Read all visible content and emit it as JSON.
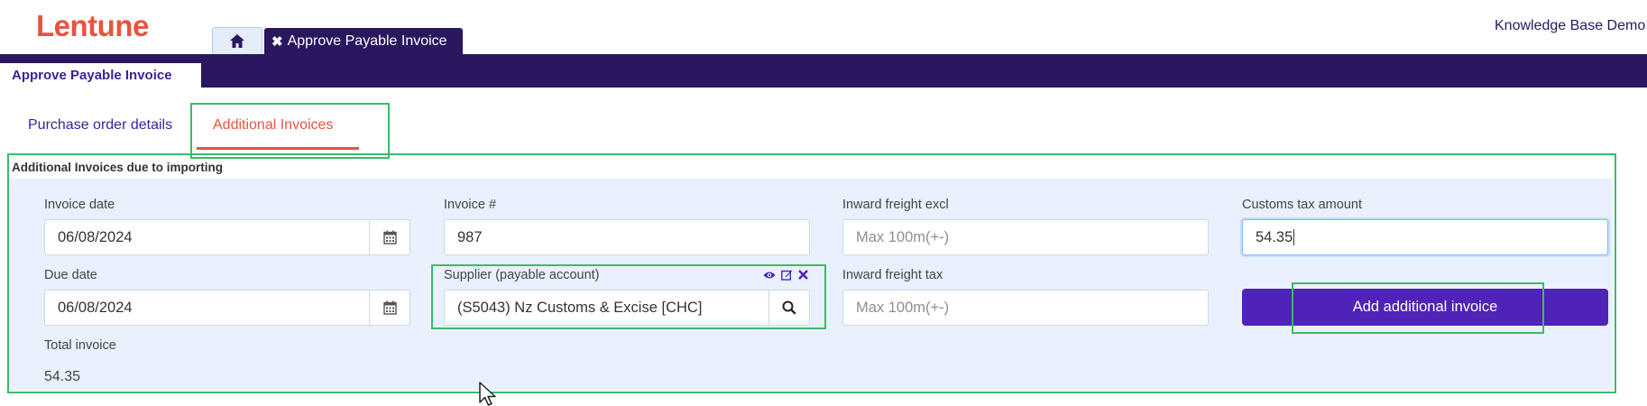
{
  "header": {
    "logo": "Lentune",
    "home_tab_icon": "home-icon",
    "active_tab_label": "Approve Payable Invoice",
    "active_tab_close_icon": "close-icon",
    "user_label": "Knowledge Base Demo"
  },
  "page_tab": {
    "label": "Approve Payable Invoice"
  },
  "subtabs": {
    "purchase_order": "Purchase order details",
    "additional_invoices": "Additional Invoices"
  },
  "section": {
    "title": "Additional Invoices due to importing"
  },
  "form": {
    "invoice_date": {
      "label": "Invoice date",
      "value": "06/08/2024",
      "icon": "calendar-icon"
    },
    "due_date": {
      "label": "Due date",
      "value": "06/08/2024",
      "icon": "calendar-icon"
    },
    "invoice_number": {
      "label": "Invoice #",
      "value": "987"
    },
    "supplier": {
      "label": "Supplier (payable account)",
      "value": "(S5043) Nz Customs & Excise [CHC]",
      "icons": [
        "eye-icon",
        "edit-icon",
        "close-icon"
      ],
      "search_icon": "search-icon"
    },
    "inward_freight_excl": {
      "label": "Inward freight excl",
      "placeholder": "Max 100m(+-)"
    },
    "inward_freight_tax": {
      "label": "Inward freight tax",
      "placeholder": "Max 100m(+-)"
    },
    "customs_tax_amount": {
      "label": "Customs tax amount",
      "value": "54.35"
    },
    "total_invoice": {
      "label": "Total invoice",
      "value": "54.35"
    },
    "add_button_label": "Add additional invoice"
  },
  "colors": {
    "brand_dark": "#2b1660",
    "brand_accent": "#e8533f",
    "button": "#4f22b8",
    "highlight": "#3cba6a",
    "section_bg": "#e8f1fd"
  }
}
